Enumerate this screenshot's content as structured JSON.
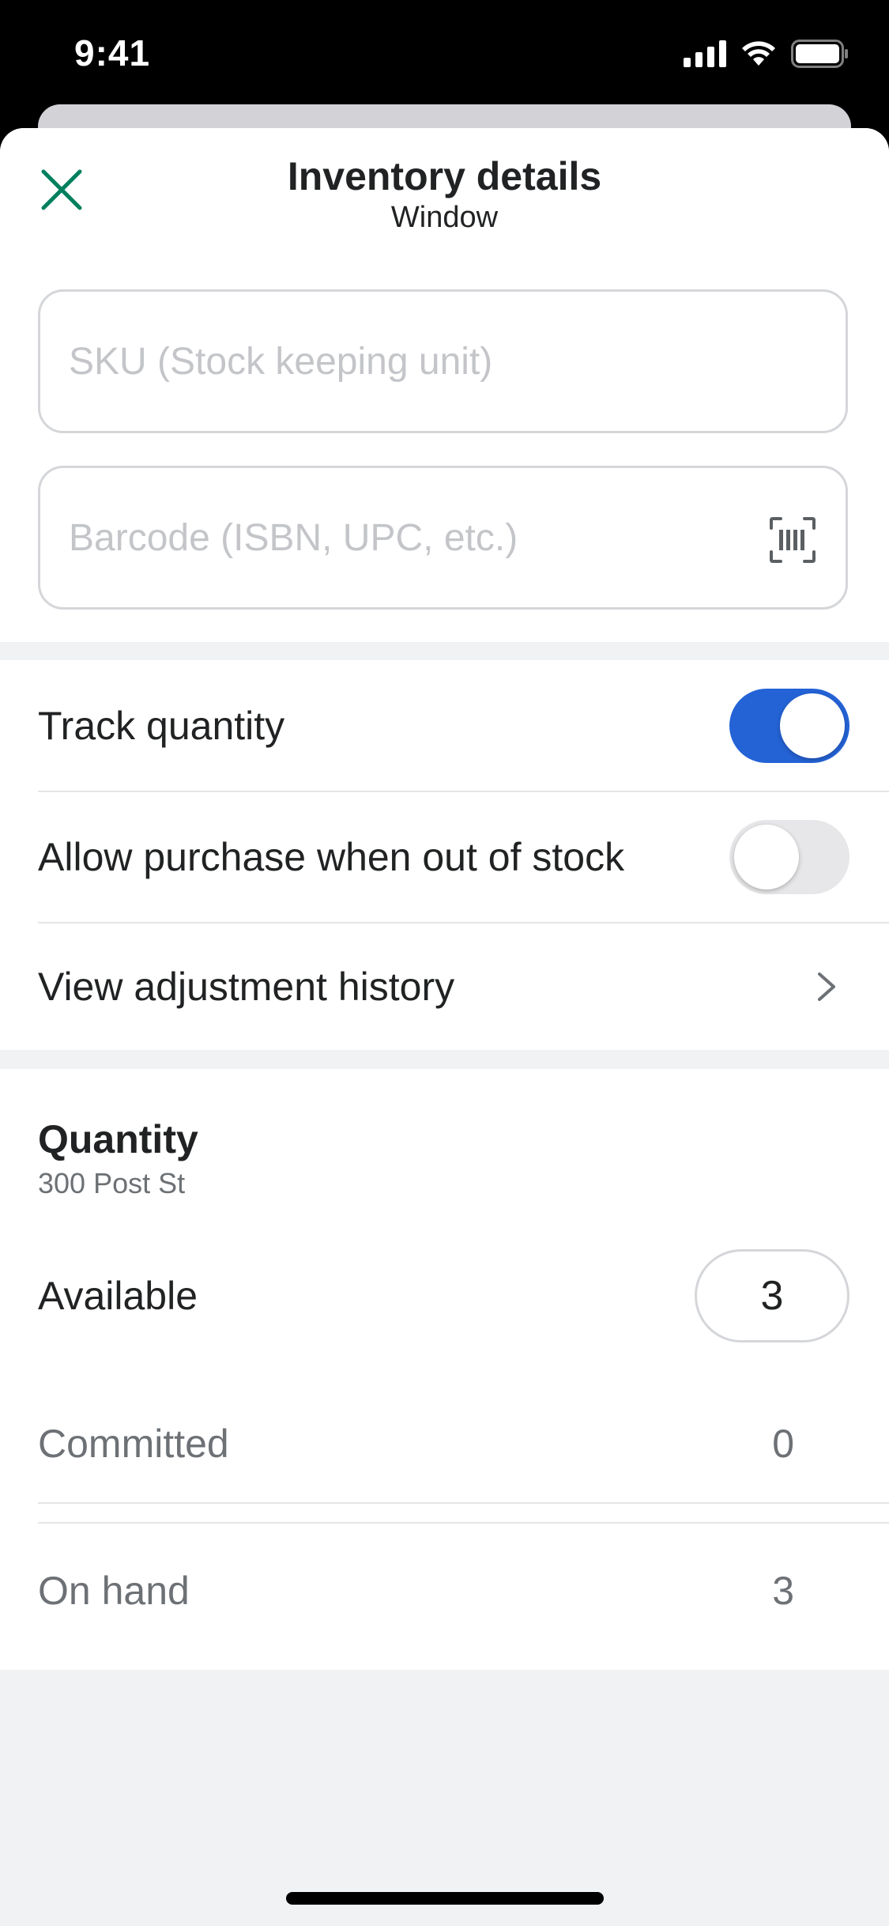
{
  "status_bar": {
    "time": "9:41"
  },
  "header": {
    "title": "Inventory details",
    "subtitle": "Window",
    "close_icon": "close-icon",
    "accent_color": "#007f5f"
  },
  "fields": {
    "sku": {
      "value": "",
      "placeholder": "SKU (Stock keeping unit)"
    },
    "barcode": {
      "value": "",
      "placeholder": "Barcode (ISBN, UPC, etc.)",
      "icon": "barcode-scan-icon"
    }
  },
  "settings": {
    "track_quantity": {
      "label": "Track quantity",
      "on": true
    },
    "allow_oos": {
      "label": "Allow purchase when out of stock",
      "on": false
    },
    "history": {
      "label": "View adjustment history",
      "icon": "chevron-right-icon"
    },
    "toggle_on_color": "#2463d6"
  },
  "quantity": {
    "title": "Quantity",
    "location": "300 Post St",
    "available": {
      "label": "Available",
      "value": "3"
    },
    "committed": {
      "label": "Committed",
      "value": "0"
    },
    "on_hand": {
      "label": "On hand",
      "value": "3"
    }
  }
}
